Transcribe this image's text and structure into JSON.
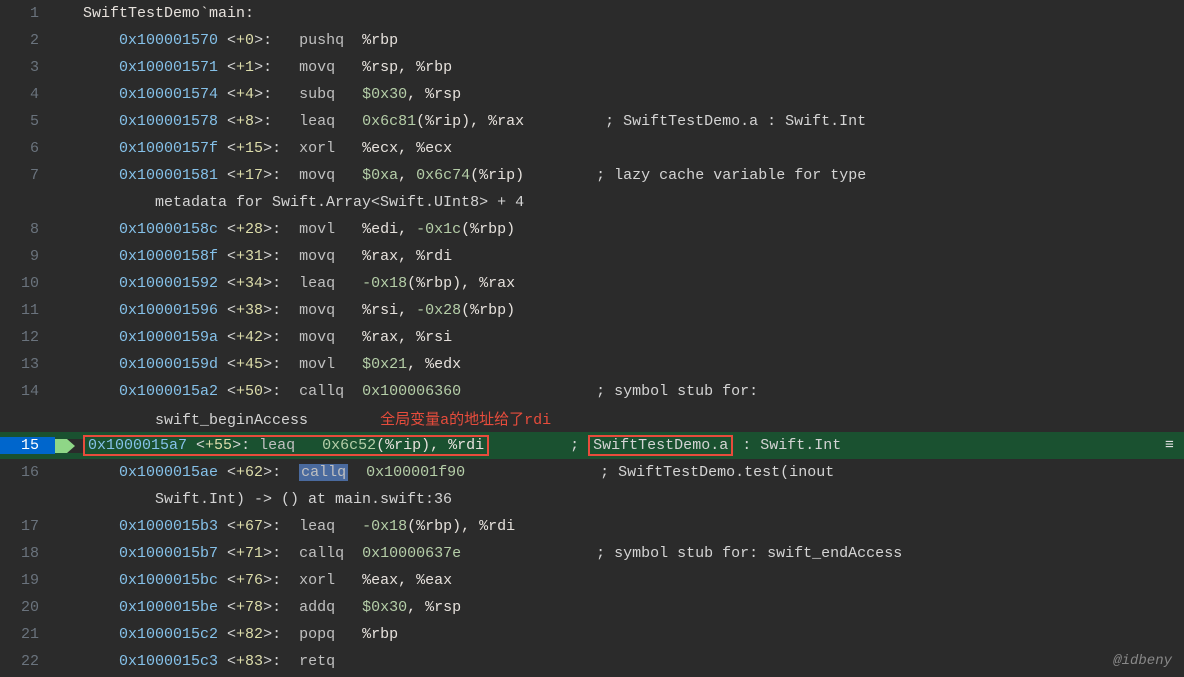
{
  "watermark": "@idbeny",
  "annotation_red": "全局变量a的地址给了rdi",
  "lines": [
    {
      "no": "1",
      "arrow": "",
      "segments": [
        {
          "cls": "label",
          "text": "SwiftTestDemo`main:"
        }
      ]
    },
    {
      "no": "2",
      "arrow": "",
      "segments": [
        {
          "cls": "addr",
          "text": "    0x100001570 "
        },
        {
          "cls": "offset-br",
          "text": "<"
        },
        {
          "cls": "offset-num",
          "text": "+0"
        },
        {
          "cls": "offset-br",
          "text": ">:   "
        },
        {
          "cls": "mnem",
          "text": "pushq  "
        },
        {
          "cls": "reg",
          "text": "%rbp"
        }
      ]
    },
    {
      "no": "3",
      "arrow": "",
      "segments": [
        {
          "cls": "addr",
          "text": "    0x100001571 "
        },
        {
          "cls": "offset-br",
          "text": "<"
        },
        {
          "cls": "offset-num",
          "text": "+1"
        },
        {
          "cls": "offset-br",
          "text": ">:   "
        },
        {
          "cls": "mnem",
          "text": "movq   "
        },
        {
          "cls": "reg",
          "text": "%rsp, %rbp"
        }
      ]
    },
    {
      "no": "4",
      "arrow": "",
      "segments": [
        {
          "cls": "addr",
          "text": "    0x100001574 "
        },
        {
          "cls": "offset-br",
          "text": "<"
        },
        {
          "cls": "offset-num",
          "text": "+4"
        },
        {
          "cls": "offset-br",
          "text": ">:   "
        },
        {
          "cls": "mnem",
          "text": "subq   "
        },
        {
          "cls": "hex",
          "text": "$0x30"
        },
        {
          "cls": "reg",
          "text": ", %rsp"
        }
      ]
    },
    {
      "no": "5",
      "arrow": "",
      "segments": [
        {
          "cls": "addr",
          "text": "    0x100001578 "
        },
        {
          "cls": "offset-br",
          "text": "<"
        },
        {
          "cls": "offset-num",
          "text": "+8"
        },
        {
          "cls": "offset-br",
          "text": ">:   "
        },
        {
          "cls": "mnem",
          "text": "leaq   "
        },
        {
          "cls": "hex",
          "text": "0x6c81"
        },
        {
          "cls": "reg",
          "text": "(%rip), %rax         "
        },
        {
          "cls": "comment",
          "text": "; SwiftTestDemo.a : Swift.Int"
        }
      ]
    },
    {
      "no": "6",
      "arrow": "",
      "segments": [
        {
          "cls": "addr",
          "text": "    0x10000157f "
        },
        {
          "cls": "offset-br",
          "text": "<"
        },
        {
          "cls": "offset-num",
          "text": "+15"
        },
        {
          "cls": "offset-br",
          "text": ">:  "
        },
        {
          "cls": "mnem",
          "text": "xorl   "
        },
        {
          "cls": "reg",
          "text": "%ecx, %ecx"
        }
      ]
    },
    {
      "no": "7",
      "arrow": "",
      "segments": [
        {
          "cls": "addr",
          "text": "    0x100001581 "
        },
        {
          "cls": "offset-br",
          "text": "<"
        },
        {
          "cls": "offset-num",
          "text": "+17"
        },
        {
          "cls": "offset-br",
          "text": ">:  "
        },
        {
          "cls": "mnem",
          "text": "movq   "
        },
        {
          "cls": "hex",
          "text": "$0xa"
        },
        {
          "cls": "reg",
          "text": ", "
        },
        {
          "cls": "hex",
          "text": "0x6c74"
        },
        {
          "cls": "reg",
          "text": "(%rip)        "
        },
        {
          "cls": "comment",
          "text": "; lazy cache variable for type"
        }
      ]
    },
    {
      "no": "",
      "arrow": "",
      "segments": [
        {
          "cls": "comment",
          "text": "        metadata for Swift.Array<Swift.UInt8> + 4"
        }
      ]
    },
    {
      "no": "8",
      "arrow": "",
      "segments": [
        {
          "cls": "addr",
          "text": "    0x10000158c "
        },
        {
          "cls": "offset-br",
          "text": "<"
        },
        {
          "cls": "offset-num",
          "text": "+28"
        },
        {
          "cls": "offset-br",
          "text": ">:  "
        },
        {
          "cls": "mnem",
          "text": "movl   "
        },
        {
          "cls": "reg",
          "text": "%edi, "
        },
        {
          "cls": "hex",
          "text": "-0x1c"
        },
        {
          "cls": "reg",
          "text": "(%rbp)"
        }
      ]
    },
    {
      "no": "9",
      "arrow": "",
      "segments": [
        {
          "cls": "addr",
          "text": "    0x10000158f "
        },
        {
          "cls": "offset-br",
          "text": "<"
        },
        {
          "cls": "offset-num",
          "text": "+31"
        },
        {
          "cls": "offset-br",
          "text": ">:  "
        },
        {
          "cls": "mnem",
          "text": "movq   "
        },
        {
          "cls": "reg",
          "text": "%rax, %rdi"
        }
      ]
    },
    {
      "no": "10",
      "arrow": "",
      "segments": [
        {
          "cls": "addr",
          "text": "    0x100001592 "
        },
        {
          "cls": "offset-br",
          "text": "<"
        },
        {
          "cls": "offset-num",
          "text": "+34"
        },
        {
          "cls": "offset-br",
          "text": ">:  "
        },
        {
          "cls": "mnem",
          "text": "leaq   "
        },
        {
          "cls": "hex",
          "text": "-0x18"
        },
        {
          "cls": "reg",
          "text": "(%rbp), %rax"
        }
      ]
    },
    {
      "no": "11",
      "arrow": "",
      "segments": [
        {
          "cls": "addr",
          "text": "    0x100001596 "
        },
        {
          "cls": "offset-br",
          "text": "<"
        },
        {
          "cls": "offset-num",
          "text": "+38"
        },
        {
          "cls": "offset-br",
          "text": ">:  "
        },
        {
          "cls": "mnem",
          "text": "movq   "
        },
        {
          "cls": "reg",
          "text": "%rsi, "
        },
        {
          "cls": "hex",
          "text": "-0x28"
        },
        {
          "cls": "reg",
          "text": "(%rbp)"
        }
      ]
    },
    {
      "no": "12",
      "arrow": "",
      "segments": [
        {
          "cls": "addr",
          "text": "    0x10000159a "
        },
        {
          "cls": "offset-br",
          "text": "<"
        },
        {
          "cls": "offset-num",
          "text": "+42"
        },
        {
          "cls": "offset-br",
          "text": ">:  "
        },
        {
          "cls": "mnem",
          "text": "movq   "
        },
        {
          "cls": "reg",
          "text": "%rax, %rsi"
        }
      ]
    },
    {
      "no": "13",
      "arrow": "",
      "segments": [
        {
          "cls": "addr",
          "text": "    0x10000159d "
        },
        {
          "cls": "offset-br",
          "text": "<"
        },
        {
          "cls": "offset-num",
          "text": "+45"
        },
        {
          "cls": "offset-br",
          "text": ">:  "
        },
        {
          "cls": "mnem",
          "text": "movl   "
        },
        {
          "cls": "hex",
          "text": "$0x21"
        },
        {
          "cls": "reg",
          "text": ", %edx"
        }
      ]
    },
    {
      "no": "14",
      "arrow": "",
      "segments": [
        {
          "cls": "addr",
          "text": "    0x1000015a2 "
        },
        {
          "cls": "offset-br",
          "text": "<"
        },
        {
          "cls": "offset-num",
          "text": "+50"
        },
        {
          "cls": "offset-br",
          "text": ">:  "
        },
        {
          "cls": "mnem",
          "text": "callq  "
        },
        {
          "cls": "hex",
          "text": "0x100006360               "
        },
        {
          "cls": "comment",
          "text": "; symbol stub for:"
        }
      ]
    },
    {
      "no": "",
      "arrow": "",
      "annotation": true,
      "segments": [
        {
          "cls": "comment",
          "text": "        swift_beginAccess        "
        }
      ]
    },
    {
      "no": "15",
      "arrow": "->",
      "highlight": true
    },
    {
      "no": "16",
      "arrow": "",
      "segments": [
        {
          "cls": "addr",
          "text": "    0x1000015ae "
        },
        {
          "cls": "offset-br",
          "text": "<"
        },
        {
          "cls": "offset-num",
          "text": "+62"
        },
        {
          "cls": "offset-br",
          "text": ">:  "
        },
        {
          "cls": "mnem callq-hl",
          "text": "callq"
        },
        {
          "cls": "mnem",
          "text": "  "
        },
        {
          "cls": "hex",
          "text": "0x100001f90               "
        },
        {
          "cls": "comment",
          "text": "; SwiftTestDemo.test(inout"
        }
      ]
    },
    {
      "no": "",
      "arrow": "",
      "segments": [
        {
          "cls": "comment",
          "text": "        Swift.Int) -> () at main.swift:36"
        }
      ]
    },
    {
      "no": "17",
      "arrow": "",
      "segments": [
        {
          "cls": "addr",
          "text": "    0x1000015b3 "
        },
        {
          "cls": "offset-br",
          "text": "<"
        },
        {
          "cls": "offset-num",
          "text": "+67"
        },
        {
          "cls": "offset-br",
          "text": ">:  "
        },
        {
          "cls": "mnem",
          "text": "leaq   "
        },
        {
          "cls": "hex",
          "text": "-0x18"
        },
        {
          "cls": "reg",
          "text": "(%rbp), %rdi"
        }
      ]
    },
    {
      "no": "18",
      "arrow": "",
      "segments": [
        {
          "cls": "addr",
          "text": "    0x1000015b7 "
        },
        {
          "cls": "offset-br",
          "text": "<"
        },
        {
          "cls": "offset-num",
          "text": "+71"
        },
        {
          "cls": "offset-br",
          "text": ">:  "
        },
        {
          "cls": "mnem",
          "text": "callq  "
        },
        {
          "cls": "hex",
          "text": "0x10000637e               "
        },
        {
          "cls": "comment",
          "text": "; symbol stub for: swift_endAccess"
        }
      ]
    },
    {
      "no": "19",
      "arrow": "",
      "segments": [
        {
          "cls": "addr",
          "text": "    0x1000015bc "
        },
        {
          "cls": "offset-br",
          "text": "<"
        },
        {
          "cls": "offset-num",
          "text": "+76"
        },
        {
          "cls": "offset-br",
          "text": ">:  "
        },
        {
          "cls": "mnem",
          "text": "xorl   "
        },
        {
          "cls": "reg",
          "text": "%eax, %eax"
        }
      ]
    },
    {
      "no": "20",
      "arrow": "",
      "segments": [
        {
          "cls": "addr",
          "text": "    0x1000015be "
        },
        {
          "cls": "offset-br",
          "text": "<"
        },
        {
          "cls": "offset-num",
          "text": "+78"
        },
        {
          "cls": "offset-br",
          "text": ">:  "
        },
        {
          "cls": "mnem",
          "text": "addq   "
        },
        {
          "cls": "hex",
          "text": "$0x30"
        },
        {
          "cls": "reg",
          "text": ", %rsp"
        }
      ]
    },
    {
      "no": "21",
      "arrow": "",
      "segments": [
        {
          "cls": "addr",
          "text": "    0x1000015c2 "
        },
        {
          "cls": "offset-br",
          "text": "<"
        },
        {
          "cls": "offset-num",
          "text": "+82"
        },
        {
          "cls": "offset-br",
          "text": ">:  "
        },
        {
          "cls": "mnem",
          "text": "popq   "
        },
        {
          "cls": "reg",
          "text": "%rbp"
        }
      ]
    },
    {
      "no": "22",
      "arrow": "",
      "segments": [
        {
          "cls": "addr",
          "text": "    0x1000015c3 "
        },
        {
          "cls": "offset-br",
          "text": "<"
        },
        {
          "cls": "offset-num",
          "text": "+83"
        },
        {
          "cls": "offset-br",
          "text": ">:  "
        },
        {
          "cls": "mnem",
          "text": "retq"
        }
      ]
    }
  ],
  "line15": {
    "addr": "0x1000015a7 ",
    "offset_l": "<",
    "offset_n": "+55",
    "offset_r": ">: ",
    "mnem": "leaq   ",
    "op1": "0x6c52",
    "op2": "(%rip), %rdi",
    "gap": "         ",
    "semi": "; ",
    "box2": "SwiftTestDemo.a",
    "tail": " : Swift.Int"
  }
}
